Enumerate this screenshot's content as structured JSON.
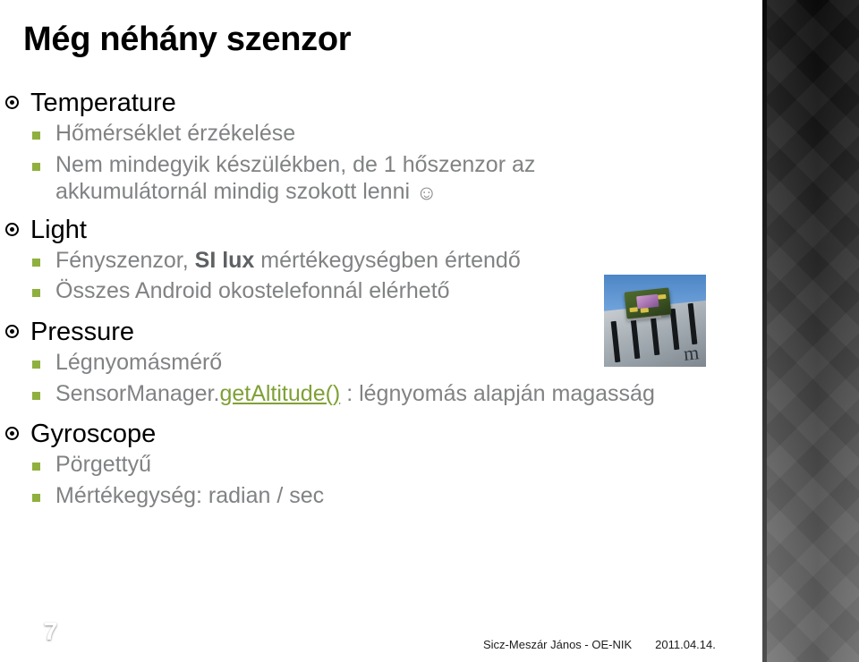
{
  "slide": {
    "title": "Még néhány szenzor",
    "page_number": "7",
    "accent_green": "#8FB03E",
    "link_green": "#7FA035",
    "body_gray": "#808284"
  },
  "footer": {
    "author": "Sicz-Meszár János - OE-NIK",
    "date": "2011.04.14."
  },
  "photo": {
    "caption": "light-sensor-chip-on-ruler",
    "ruler_letter": "m"
  },
  "content": {
    "sections": [
      {
        "heading": "Temperature",
        "bullets": [
          {
            "text": "Hőmérséklet érzékelése"
          },
          {
            "text": "Nem mindegyik készülékben, de 1 hőszenzor az"
          },
          {
            "text": "akkumulátornál mindig szokott lenni",
            "smiley": "☺",
            "continuation": true
          }
        ]
      },
      {
        "heading": "Light",
        "bullets": [
          {
            "pre": "Fényszenzor, ",
            "bold": "SI lux",
            "post": " mértékegységben értendő"
          },
          {
            "text": "Összes Android okostelefonnál elérhető"
          }
        ]
      },
      {
        "heading": "Pressure",
        "bullets": [
          {
            "text": "Légnyomásmérő"
          },
          {
            "pre": "SensorManager.",
            "link": "getAltitude()",
            "post": " : légnyomás alapján magasság"
          }
        ]
      },
      {
        "heading": "Gyroscope",
        "bullets": [
          {
            "text": "Pörgettyű"
          },
          {
            "text": "Mértékegység: radian / sec"
          }
        ]
      }
    ]
  }
}
